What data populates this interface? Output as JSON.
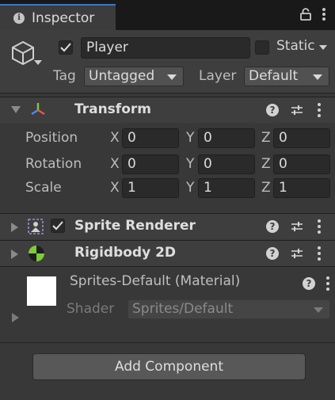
{
  "tab": {
    "title": "Inspector",
    "icon": "info-icon"
  },
  "header": {
    "object_name": "Player",
    "active_checked": true,
    "static_label": "Static",
    "static_checked": false,
    "tag_label": "Tag",
    "tag_value": "Untagged",
    "layer_label": "Layer",
    "layer_value": "Default"
  },
  "transform": {
    "title": "Transform",
    "rows": [
      {
        "label": "Position",
        "x": "0",
        "y": "0",
        "z": "0"
      },
      {
        "label": "Rotation",
        "x": "0",
        "y": "0",
        "z": "0"
      },
      {
        "label": "Scale",
        "x": "1",
        "y": "1",
        "z": "1"
      }
    ],
    "axis_labels": {
      "x": "X",
      "y": "Y",
      "z": "Z"
    }
  },
  "sprite_renderer": {
    "title": "Sprite Renderer",
    "enabled": true
  },
  "rigidbody": {
    "title": "Rigidbody 2D"
  },
  "material": {
    "title": "Sprites-Default (Material)",
    "shader_label": "Shader",
    "shader_value": "Sprites/Default"
  },
  "add_component_label": "Add Component",
  "colors": {
    "accent": "#3a79bb",
    "rigidbody_icon": "#7ecb3a",
    "background": "#383838"
  }
}
